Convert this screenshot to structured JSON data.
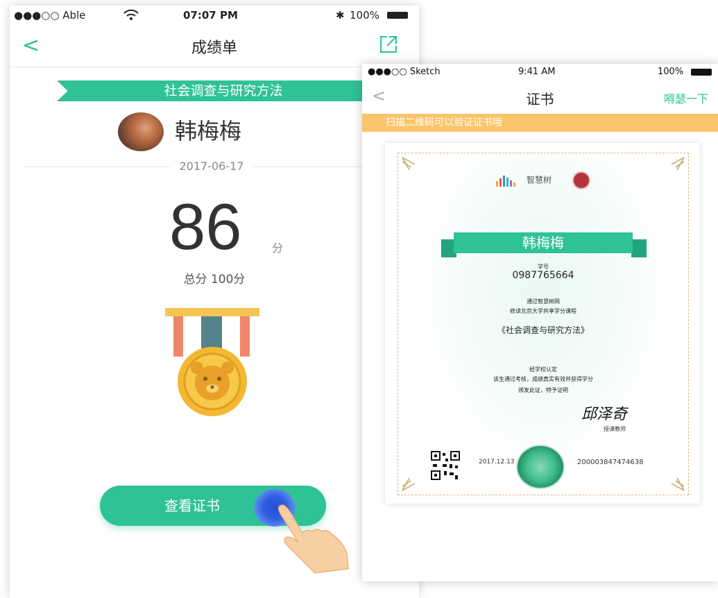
{
  "left": {
    "status": {
      "carrier": "●●●○○ Able",
      "time": "07:07 PM",
      "battery": "100%"
    },
    "nav": {
      "back": "<",
      "title": "成绩单"
    },
    "course": "社会调查与研究方法",
    "user_name": "韩梅梅",
    "date": "2017-06-17",
    "score": "86",
    "score_unit": "分",
    "total": "总分 100分",
    "view_button": "查看证书"
  },
  "right": {
    "status": {
      "carrier": "●●●○○ Sketch",
      "time": "9:41 AM",
      "battery": "100%"
    },
    "nav": {
      "back": "<",
      "title": "证书",
      "action": "嘚瑟一下"
    },
    "notice": "扫描二维码可以验证证书哦",
    "certificate": {
      "brand": "智慧树",
      "name": "韩梅梅",
      "student_id_label": "学号",
      "student_id": "0987765664",
      "line1": "通过智慧树网",
      "line2": "修读北京大学共享学分课程",
      "course": "《社会调查与研究方法》",
      "confirm": "经学校认定",
      "statement": "该生通过考核，成绩真实有效并获得学分",
      "award": "颁发此证，特予证明",
      "signature": "邱泽奇",
      "signer_title": "授课教师",
      "issue_date": "2017.12.13",
      "cert_no": "200003847474638"
    }
  },
  "colors": {
    "accent": "#2fc296",
    "notice": "#fbc46b",
    "seal": "#b3343c"
  }
}
